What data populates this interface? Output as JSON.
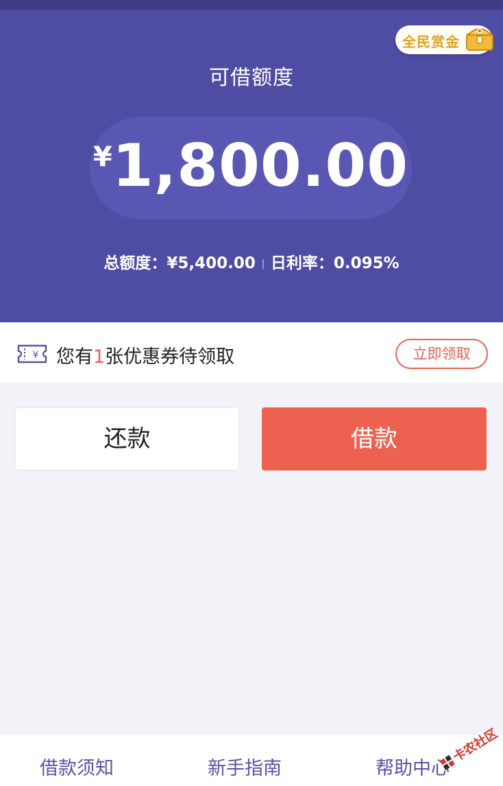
{
  "header": {
    "reward_badge": "全民赏金",
    "title": "可借额度",
    "currency_symbol": "¥",
    "available_amount": "1,800.00",
    "total_quota": "总额度：¥5,400.00",
    "daily_rate": "日利率：0.095%"
  },
  "coupon": {
    "prefix": "您有",
    "count": "1",
    "suffix": "张优惠券待领取",
    "icon": "coupon-ticket-icon",
    "claim_label": "立即领取"
  },
  "actions": {
    "repay_label": "还款",
    "borrow_label": "借款"
  },
  "bottom_nav": {
    "items": [
      {
        "label": "借款须知"
      },
      {
        "label": "新手指南"
      },
      {
        "label": "帮助中心"
      }
    ]
  },
  "watermark": {
    "text": "卡农社区"
  },
  "colors": {
    "header_bg": "#4f4ca4",
    "amount_pill": "#5957b3",
    "accent_red": "#ec6150",
    "nav_text": "#5552a6",
    "reward_gold": "#e0a321",
    "page_bg": "#f3f2f8"
  }
}
